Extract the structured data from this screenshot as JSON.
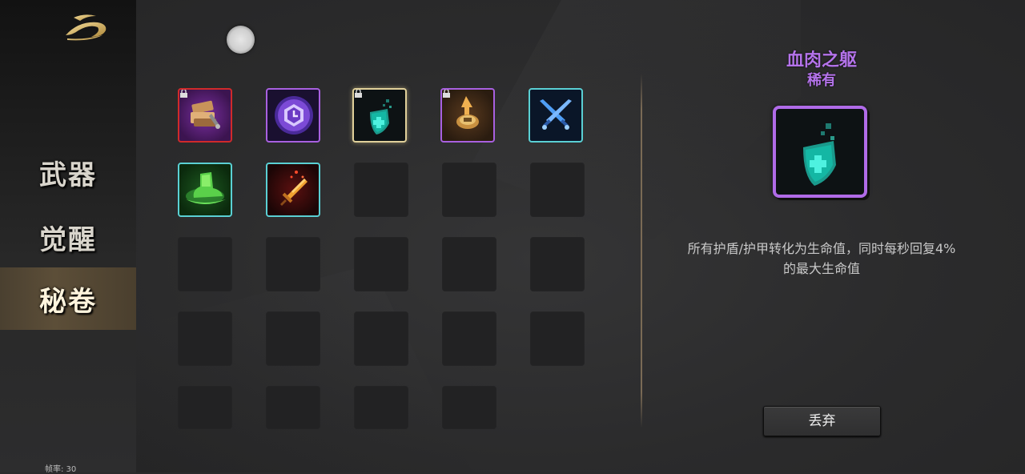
{
  "sidebar": {
    "logo": "golden-dragon-logo",
    "items": [
      {
        "label": "武器"
      },
      {
        "label": "觉醒"
      },
      {
        "label": "秘卷"
      }
    ],
    "active_index": 2,
    "fps": "帧率: 30"
  },
  "inventory": {
    "items": [
      {
        "icon": "tome-stack-icon",
        "rarity_color": "#d02a2a",
        "locked": true
      },
      {
        "icon": "purple-clock-orb-icon",
        "rarity_color": "#a860e0",
        "locked": false
      },
      {
        "icon": "teal-shield-icon",
        "rarity_color": "#e0d09a",
        "locked": true,
        "selected": true
      },
      {
        "icon": "golden-arrow-medal-icon",
        "rarity_color": "#a860e0",
        "locked": true
      },
      {
        "icon": "crossed-blue-swords-icon",
        "rarity_color": "#5ad0d4",
        "locked": false
      },
      {
        "icon": "green-boot-icon",
        "rarity_color": "#5ad0d4",
        "locked": false
      },
      {
        "icon": "flaming-sword-icon",
        "rarity_color": "#5ad0d4",
        "locked": false
      }
    ],
    "empty_slots": 17
  },
  "detail": {
    "title": "血肉之躯",
    "rarity": "稀有",
    "icon": "teal-shield-icon",
    "accent_color": "#b473ea",
    "description": "所有护盾/护甲转化为生命值，同时每秒回复4%的最大生命值",
    "discard_label": "丢弃"
  }
}
